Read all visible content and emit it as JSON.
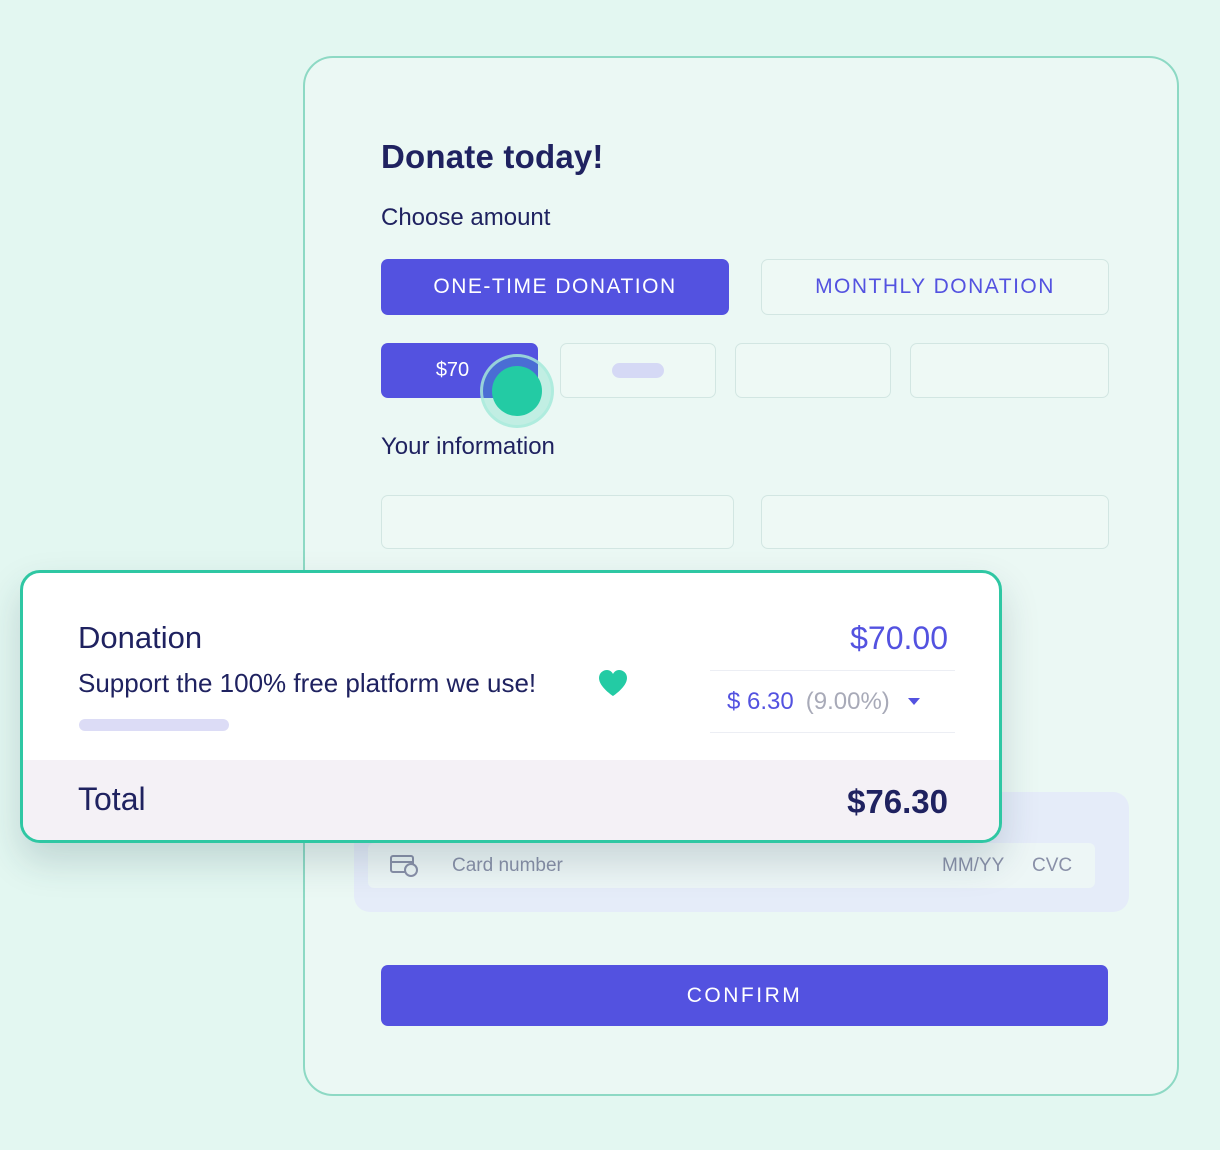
{
  "form": {
    "title": "Donate today!",
    "choose_amount_label": "Choose amount",
    "frequency": {
      "one_time_label": "ONE-TIME DONATION",
      "monthly_label": "MONTHLY DONATION",
      "selected": "one-time"
    },
    "amounts": [
      {
        "label": "$70",
        "selected": true
      }
    ],
    "your_information_label": "Your information",
    "card": {
      "icon": "credit-card-icon",
      "number_placeholder": "Card number",
      "expiry_placeholder": "MM/YY",
      "cvc_placeholder": "CVC"
    },
    "confirm_label": "CONFIRM"
  },
  "summary": {
    "donation_label": "Donation",
    "donation_amount": "$70.00",
    "support_text": "Support the 100% free platform we use!",
    "support_icon": "heart-icon",
    "tip_value": "$ 6.30",
    "tip_percent": "(9.00%)",
    "total_label": "Total",
    "total_value": "$76.30"
  },
  "colors": {
    "accent": "#5352e0",
    "teal": "#2fc7a3",
    "text": "#1f2260",
    "background": "#e3f7f1"
  }
}
